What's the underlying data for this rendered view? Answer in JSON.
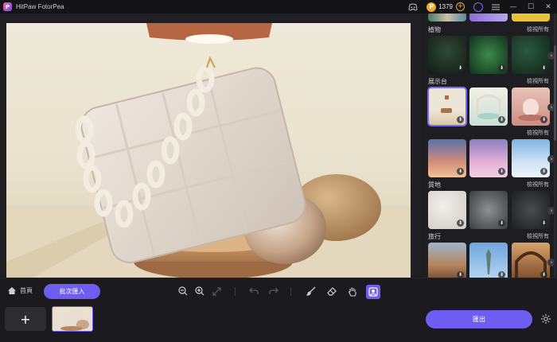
{
  "window": {
    "title": "HitPaw FotorPea",
    "logo_letter": "P",
    "coins": "1379",
    "coin_letter": "P",
    "coin_add": "+",
    "controls": {
      "minimize": "—",
      "maximize": "☐",
      "close": "✕"
    }
  },
  "panel": {
    "sections": [
      {
        "title": "植物",
        "view_all": "檢視所有"
      },
      {
        "title": "展示台",
        "view_all": "檢視所有"
      },
      {
        "title": "",
        "view_all": "檢視所有"
      },
      {
        "title": "質地",
        "view_all": "檢視所有"
      },
      {
        "title": "旅行",
        "view_all": "檢視所有"
      }
    ],
    "download_glyph": "⬇",
    "next_glyph": "›"
  },
  "toolbar": {
    "home_label": "首頁",
    "batch_label": "批次匯入"
  },
  "strip": {
    "add_label": "+",
    "export_label": "匯出"
  },
  "colors": {
    "accent": "#6f5cf0",
    "coin": "#f3a81d",
    "background": "#1b1b1f"
  },
  "icons": [
    "discord-icon",
    "coin-icon",
    "user-icon",
    "menu-icon",
    "zoom-out-icon",
    "zoom-in-icon",
    "fit-icon",
    "undo-icon",
    "redo-icon",
    "brush-icon",
    "eraser-icon",
    "hand-icon",
    "compare-icon",
    "settings-icon",
    "home-icon"
  ]
}
